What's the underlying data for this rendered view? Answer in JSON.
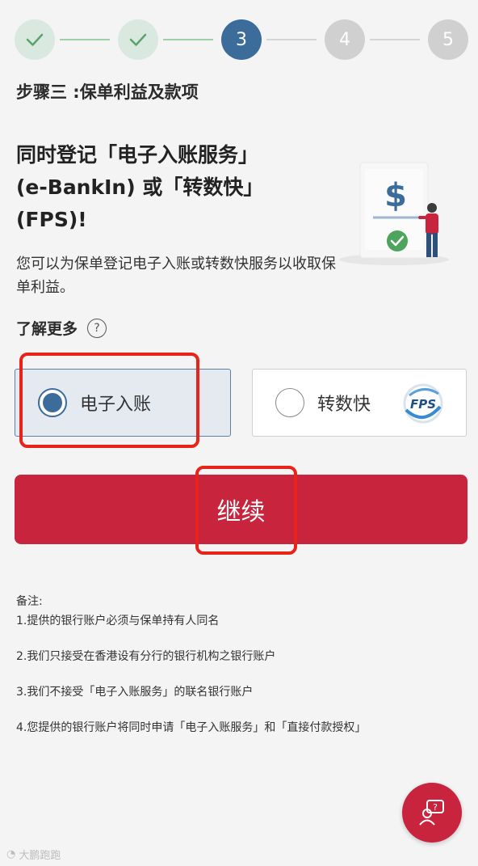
{
  "stepper": {
    "steps": [
      {
        "label": "",
        "state": "done"
      },
      {
        "label": "",
        "state": "done"
      },
      {
        "label": "3",
        "state": "current"
      },
      {
        "label": "4",
        "state": "todo"
      },
      {
        "label": "5",
        "state": "todo"
      }
    ]
  },
  "step_title": "步骤三 :保单利益及款项",
  "headline": {
    "line1": "同时登记「电子入账服务」",
    "line2": "(e-BankIn) 或「转数快」",
    "line3": "(FPS)!"
  },
  "subtext": "您可以为保单登记电子入账或转数快服务以收取保单利益。",
  "learn_more": {
    "label": "了解更多",
    "icon": "?"
  },
  "options": [
    {
      "label": "电子入账",
      "selected": true
    },
    {
      "label": "转数快",
      "selected": false,
      "logo_text": "FPS"
    }
  ],
  "continue_label": "继续",
  "notes": {
    "title": "备注:",
    "items": [
      "1.提供的银行账户必须与保单持有人同名",
      "2.我们只接受在香港设有分行的银行机构之银行账户",
      "3.我们不接受「电子入账服务」的联名银行账户",
      "4.您提供的银行账户将同时申请「电子入账服务」和「直接付款授权」"
    ]
  },
  "illustration": {
    "symbol": "$"
  },
  "watermark": "大鹏跑跑",
  "colors": {
    "primary": "#c8243e",
    "accent_blue": "#3b6c9a",
    "done_green": "#9fcfa8",
    "highlight_red": "#e8231a"
  }
}
